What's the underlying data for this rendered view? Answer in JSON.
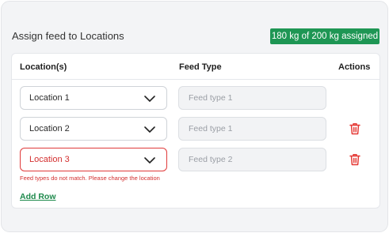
{
  "header": {
    "title": "Assign feed to Locations",
    "badge": "180 kg of 200 kg assigned"
  },
  "table": {
    "columns": [
      "Location(s)",
      "Feed Type",
      "Actions"
    ],
    "rows": [
      {
        "location": "Location 1",
        "feed_type": "Feed type 1",
        "error": false,
        "deletable": false
      },
      {
        "location": "Location 2",
        "feed_type": "Feed type 1",
        "error": false,
        "deletable": true
      },
      {
        "location": "Location 3",
        "feed_type": "Feed type 2",
        "error": true,
        "deletable": true
      }
    ],
    "error_message": "Feed types do not match. Please change the location",
    "add_row_label": "Add Row"
  },
  "colors": {
    "accent_green": "#1e9654",
    "error_red": "#e03a3a",
    "trash_red": "#e53935"
  },
  "icons": {
    "dropdown": "chevron-down-icon",
    "delete": "trash-icon"
  }
}
